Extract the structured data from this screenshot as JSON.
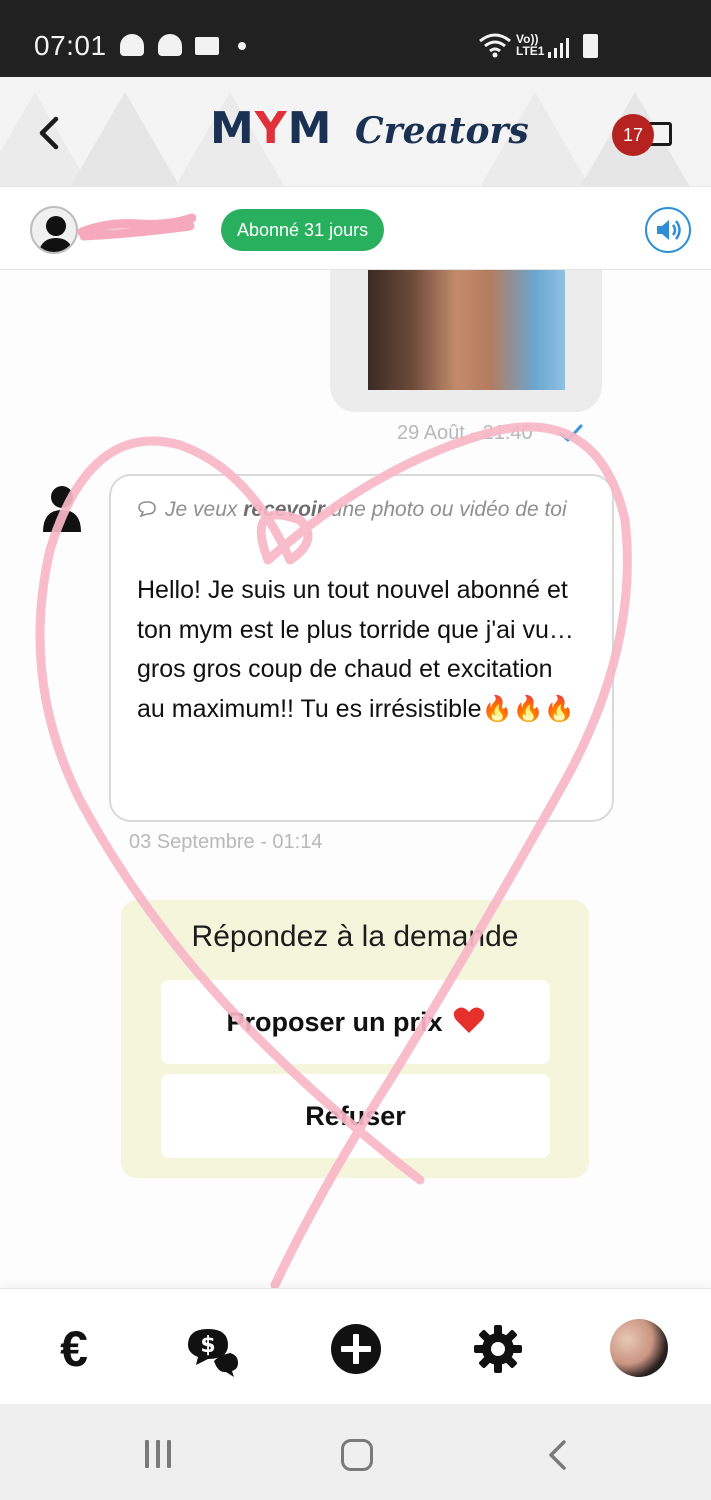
{
  "status_bar": {
    "time": "07:01",
    "network": "Vo)) LTE1"
  },
  "header": {
    "logo_main": "MYM",
    "logo_sub": "Creators",
    "notification_count": "17"
  },
  "subscriber": {
    "badge": "Abonné 31 jours"
  },
  "chat": {
    "sent_time": "29 Août - 21:40",
    "request_label_prefix": "Je veux ",
    "request_label_bold": "recevoir",
    "request_label_suffix": " une photo ou vidéo de toi",
    "message": "Hello! Je suis un tout nouvel abonné et ton mym est le plus torride que j'ai vu… gros gros coup de chaud et excitation au maximum!! Tu es irrésistible🔥🔥🔥",
    "received_time": "03 Septembre - 01:14"
  },
  "request_panel": {
    "title": "Répondez à la demande",
    "propose_label": "Proposer un prix",
    "refuse_label": "Refuser"
  },
  "colors": {
    "brand_navy": "#1b3154",
    "brand_red": "#e0303b",
    "subscribed_green": "#28b05e",
    "badge_red": "#b5221f",
    "panel_yellow": "#f5f5dc",
    "heart_overlay_pink": "#f7b6c6"
  },
  "bottom_nav": {
    "items": [
      "euro-icon",
      "chat-money-icon",
      "plus-circle-icon",
      "gear-icon",
      "profile-avatar"
    ]
  }
}
